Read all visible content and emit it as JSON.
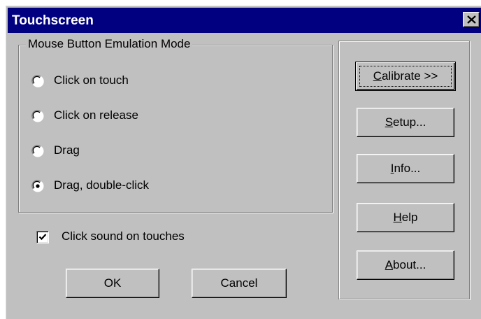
{
  "window": {
    "title": "Touchscreen",
    "close_glyph": "close-icon"
  },
  "emulation_group": {
    "legend": "Mouse Button Emulation Mode",
    "options": [
      {
        "label": "Click on touch",
        "selected": false
      },
      {
        "label": "Click on release",
        "selected": false
      },
      {
        "label": "Drag",
        "selected": false
      },
      {
        "label": "Drag, double-click",
        "selected": true
      }
    ]
  },
  "click_sound": {
    "label": "Click sound on touches",
    "checked": true
  },
  "buttons": {
    "ok": "OK",
    "cancel": "Cancel",
    "calibrate": {
      "mnemonic": "C",
      "rest": "alibrate >>"
    },
    "setup": {
      "mnemonic": "S",
      "rest": "etup..."
    },
    "info": {
      "mnemonic": "I",
      "rest": "nfo..."
    },
    "help": {
      "mnemonic": "H",
      "rest": "elp"
    },
    "about": {
      "mnemonic": "A",
      "rest": "bout..."
    }
  },
  "colors": {
    "titlebar": "#000080",
    "face": "#c0c0c0",
    "title_text": "#ffffff"
  }
}
